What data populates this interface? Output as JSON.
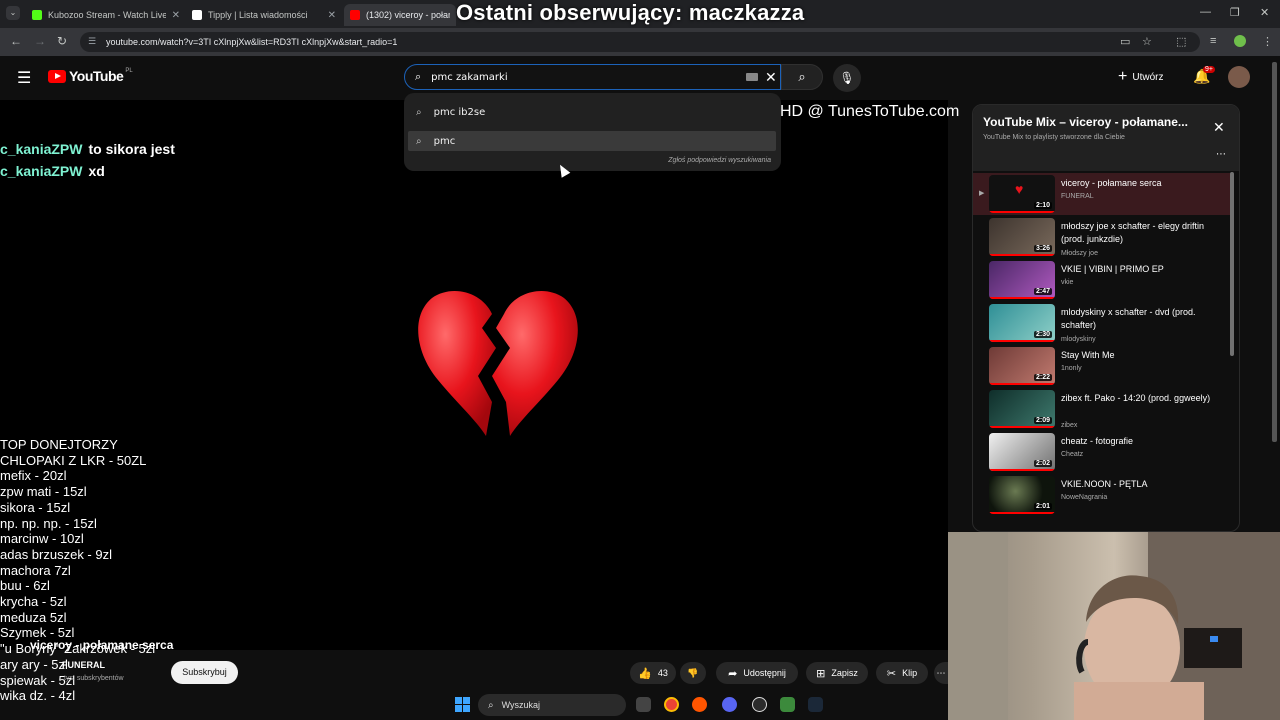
{
  "browser": {
    "tabs": [
      {
        "title": "Kubozoo Stream - Watch Live o",
        "favicon_color": "#53fc18"
      },
      {
        "title": "Tipply | Lista wiadomości",
        "favicon_color": "#ffffff"
      },
      {
        "title": "(1302) viceroy - połamane",
        "favicon_color": "#ff0000"
      }
    ],
    "url": "youtube.com/watch?v=3TI cXlnpjXw&list=RD3TI cXlnpjXw&start_radio=1"
  },
  "stream_overlay_title": "Ostatni obserwujący: maczkazza",
  "youtube": {
    "logo_text": "YouTube",
    "country_code": "PL",
    "search": {
      "value": "pmc zakamarki"
    },
    "suggestions": [
      "pmc ib2se",
      "pmc"
    ],
    "report_text": "Zgłoś podpowiedzi wyszukiwania",
    "create_label": "Utwórz",
    "notification_count": "9+"
  },
  "video": {
    "watermark": "HD @ TunesToTube.com",
    "chat": [
      {
        "user": "c_kaniaZPW",
        "message": "to sikora jest"
      },
      {
        "user": "c_kaniaZPW",
        "message": "xd"
      }
    ],
    "donors_heading": "TOP DONEJTORZY",
    "donors": [
      "CHLOPAKI Z LKR - 50ZL",
      "mefix - 20zl",
      "zpw mati - 15zl",
      "sikora - 15zl",
      "np. np. np. - 15zl",
      "marcinw - 10zl",
      "adas brzuszek - 9zl",
      "machora 7zl",
      "buu - 6zl",
      "krycha - 5zl",
      "meduza 5zl",
      "Szymek - 5zl",
      "\"u Boryny\" Zakrzówek - 5zl",
      "ary ary - 5zl",
      "spiewak - 5zl",
      "wika dz. - 4zl"
    ],
    "title": "viceroy - połamane serca",
    "channel": "FUNERAL",
    "subscribers": "tys. subskrybentów",
    "subscribe_label": "Subskrybuj",
    "likes": "43",
    "share_label": "Udostępnij",
    "save_label": "Zapisz",
    "clip_label": "Klip"
  },
  "taskbar": {
    "search_label": "Wyszukaj"
  },
  "mix": {
    "title": "YouTube Mix – viceroy - połamane...",
    "subtitle": "YouTube Mix to playlisty stworzone dla Ciebie",
    "items": [
      {
        "title": "viceroy - połamane serca",
        "channel": "FUNERAL",
        "duration": "2:10",
        "thumb": "#111111"
      },
      {
        "title": "młodszy joe x schafter - elegy driftin (prod. junkzdie)",
        "channel": "Młodszy joe",
        "duration": "3:26",
        "thumb": "#5a5048"
      },
      {
        "title": "VKIE | VIBIN | PRIMO EP",
        "channel": "vkie",
        "duration": "2:47",
        "thumb": "#7a3f8a"
      },
      {
        "title": "mlodyskiny x schafter - dvd (prod. schafter)",
        "channel": "mlodyskiny",
        "duration": "2:30",
        "thumb": "#4aa4a8"
      },
      {
        "title": "Stay With Me",
        "channel": "1nonly",
        "duration": "2:22",
        "thumb": "#a05a52"
      },
      {
        "title": "zibex ft. Pako - 14:20 (prod. ggweely)",
        "channel": "zibex",
        "duration": "2:09",
        "thumb": "#1f4a44"
      },
      {
        "title": "cheatz - fotografie",
        "channel": "Cheatz",
        "duration": "2:02",
        "thumb": "#cfcfcf"
      },
      {
        "title": "VKIE.NOON - PĘTLA",
        "channel": "NoweNagrania",
        "duration": "2:01",
        "thumb": "#1a2418"
      }
    ]
  },
  "colors": {
    "youtube_red": "#ff0000",
    "chat_username": "#7ff2d2",
    "search_focus": "#1c62b9",
    "active_item": "#3a1a1e"
  },
  "icons": [
    "hamburger-icon",
    "search-icon",
    "clear-icon",
    "mic-icon",
    "plus-icon",
    "bell-icon",
    "like-icon",
    "dislike-icon",
    "share-icon",
    "save-icon",
    "clip-icon",
    "close-icon",
    "more-icon",
    "broken-heart-icon",
    "windows-start-icon"
  ]
}
